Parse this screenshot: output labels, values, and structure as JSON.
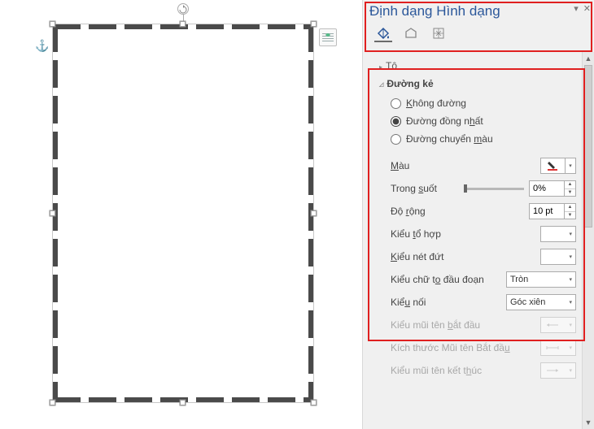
{
  "panel": {
    "title": "Định dạng Hình dạng",
    "tabs": [
      "fill-outline",
      "effects",
      "size"
    ],
    "sections": {
      "fill": "Tô",
      "line": "Đường kẻ"
    },
    "line_options": {
      "none": "Không đường",
      "solid": "Đường đồng nhất",
      "gradient": "Đường chuyển màu",
      "selected": "solid"
    },
    "props": {
      "color": "Màu",
      "transparency": "Trong suốt",
      "transparency_value": "0%",
      "width": "Độ rộng",
      "width_value": "10 pt",
      "compound": "Kiểu tổ hợp",
      "dash": "Kiểu nét đứt",
      "cap": "Kiểu chữ to đầu đoạn",
      "cap_value": "Tròn",
      "join": "Kiểu nối",
      "join_value": "Góc xiên",
      "begin_arrow": "Kiểu mũi tên bắt đầu",
      "begin_size": "Kích thước Mũi tên Bắt đầu",
      "end_arrow": "Kiểu mũi tên kết thúc"
    }
  }
}
